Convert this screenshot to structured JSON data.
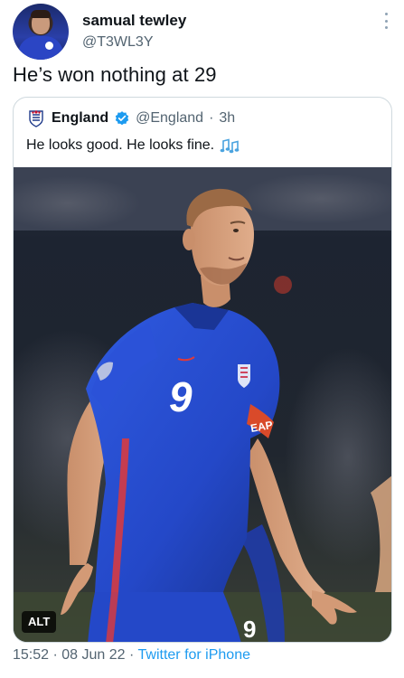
{
  "tweet": {
    "display_name": "samual tewley",
    "handle": "@T3WL3Y",
    "text": "He’s won nothing at 29",
    "time": "15:52",
    "separator": "·",
    "date": "08 Jun 22",
    "source": "Twitter for iPhone"
  },
  "quoted_tweet": {
    "display_name": "England",
    "verified": true,
    "handle": "@England",
    "separator": "·",
    "age": "3h",
    "text": "He looks good. He looks fine.",
    "emoji": "music-notes-icon",
    "media_alt_label": "ALT",
    "shirt_number": "9",
    "armband_text": "EAP"
  },
  "colors": {
    "text_primary": "#0f1419",
    "text_secondary": "#536471",
    "link_blue": "#1d9bf0",
    "border": "#cfd9de",
    "shirt_blue": "#2448c8"
  }
}
